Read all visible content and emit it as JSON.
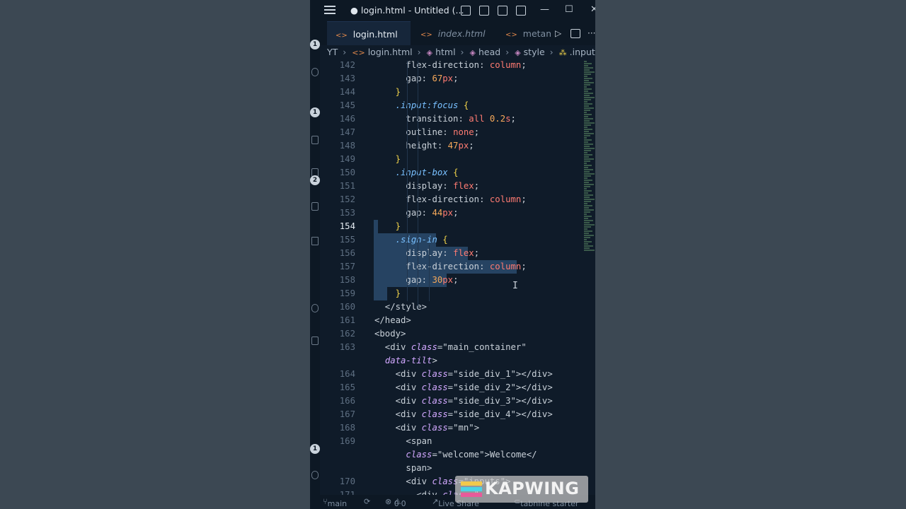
{
  "window": {
    "title": "● login.html - Untitled (...",
    "minimize_glyph": "—",
    "maximize_glyph": "☐",
    "close_glyph": "✕"
  },
  "tabs": [
    {
      "label": "login.html",
      "state": "active"
    },
    {
      "label": "index.html",
      "state": "inactive"
    },
    {
      "label": "metama",
      "state": "partial"
    }
  ],
  "tab_icon": "<>",
  "tab_actions": {
    "run_icon": "play-icon",
    "split_icon": "split-editor-icon",
    "more": "···"
  },
  "breadcrumb": [
    "YT",
    "login.html",
    "html",
    "head",
    "style",
    ".input"
  ],
  "activity_badges": [
    "1",
    "1",
    "2",
    "1"
  ],
  "code_lines": [
    {
      "n": "142",
      "text": "      flex-direction: column;"
    },
    {
      "n": "143",
      "text": "      gap: 67px;"
    },
    {
      "n": "144",
      "text": "    }"
    },
    {
      "n": "145",
      "text": "    .input:focus {"
    },
    {
      "n": "146",
      "text": "      transition: all 0.2s;"
    },
    {
      "n": "147",
      "text": "      outline: none;"
    },
    {
      "n": "148",
      "text": "      height: 47px;"
    },
    {
      "n": "149",
      "text": "    }"
    },
    {
      "n": "150",
      "text": "    .input-box {"
    },
    {
      "n": "151",
      "text": "      display: flex;"
    },
    {
      "n": "152",
      "text": "      flex-direction: column;"
    },
    {
      "n": "153",
      "text": "      gap: 44px;"
    },
    {
      "n": "154",
      "text": "    }"
    },
    {
      "n": "155",
      "text": "    .sign-in {"
    },
    {
      "n": "156",
      "text": "      display: flex;"
    },
    {
      "n": "157",
      "text": "      flex-direction: column;"
    },
    {
      "n": "158",
      "text": "      gap: 30px;"
    },
    {
      "n": "159",
      "text": "    }"
    },
    {
      "n": "160",
      "text": "  </style>"
    },
    {
      "n": "161",
      "text": "</head>"
    },
    {
      "n": "162",
      "text": "<body>"
    },
    {
      "n": "163",
      "text": "  <div class=\"main_container\""
    },
    {
      "n": "",
      "text": "  data-tilt>"
    },
    {
      "n": "164",
      "text": "    <div class=\"side_div_1\"></div>"
    },
    {
      "n": "165",
      "text": "    <div class=\"side_div_2\"></div>"
    },
    {
      "n": "166",
      "text": "    <div class=\"side_div_3\"></div>"
    },
    {
      "n": "167",
      "text": "    <div class=\"side_div_4\"></div>"
    },
    {
      "n": "168",
      "text": "    <div class=\"mn\">"
    },
    {
      "n": "169",
      "text": "      <span"
    },
    {
      "n": "",
      "text": "      class=\"welcome\">Welcome</"
    },
    {
      "n": "",
      "text": "      span>"
    },
    {
      "n": "170",
      "text": "      <div class=\"inputs\">"
    },
    {
      "n": "171",
      "text": "        <div class=\""
    }
  ],
  "current_line": "154",
  "status": {
    "branch": "main",
    "sync_icon": "sync-icon",
    "errors": "0",
    "warnings": "0",
    "live_share": "Live Share",
    "tabnine": "tabnine starter"
  },
  "watermark": {
    "text": "KAPWING"
  },
  "colors": {
    "background": "#3d4a55",
    "editor": "#0f1b29",
    "selection": "#264362",
    "number": "#f6a95a",
    "keyword": "#ff7b72",
    "selector": "#79c0ff",
    "brace": "#f1d34a",
    "attribute": "#d2a8ff"
  }
}
